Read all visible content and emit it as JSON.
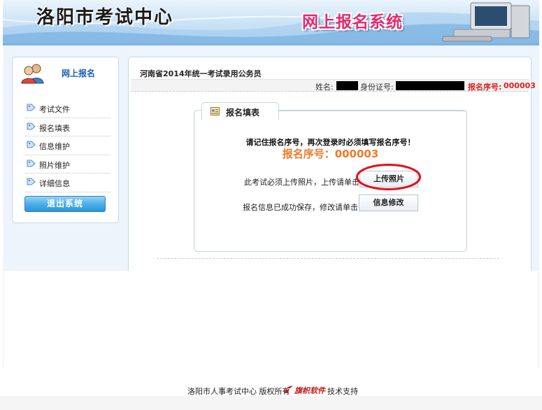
{
  "header": {
    "site_title": "洛阳市考试中心",
    "system_title": "网上报名系统"
  },
  "sidebar": {
    "title": "网上报名",
    "items": [
      {
        "label": "考试文件"
      },
      {
        "label": "报名填表"
      },
      {
        "label": "信息维护"
      },
      {
        "label": "照片维护"
      },
      {
        "label": "详细信息"
      }
    ],
    "logout_label": "退出系统"
  },
  "content": {
    "exam_title": "河南省2014年统一考试录用公务员",
    "name_label": "姓名:",
    "id_label": "身份证号:",
    "seq_label": "报名序号:",
    "seq_value": "000003"
  },
  "form": {
    "tab_label": "报名填表",
    "reminder": "请记住报名序号，再次登录时必须填写报名序号！",
    "seq_display": "报名序号：000003",
    "photo_prompt": "此考试必须上传照片，上传请单击",
    "upload_button": "上传照片",
    "saved_prompt": "报名信息已成功保存，修改请单击",
    "edit_button": "信息修改"
  },
  "footer": {
    "copyright": "洛阳市人事考试中心 版权所有",
    "brand": "旗帜软件",
    "support": "技术支持"
  },
  "colors": {
    "accent_blue": "#1a5fb4",
    "alert_red": "#e02020",
    "seq_orange": "#f07a2a",
    "highlight_oval": "#e0121b",
    "system_title_pink": "#e42a6e"
  },
  "icons": {
    "sidebar_header": "users-icon",
    "menu_item": "tag-icon",
    "form_tab": "form-icon",
    "footer_brand": "brand-logo-icon",
    "header_art": "computer-icon"
  }
}
